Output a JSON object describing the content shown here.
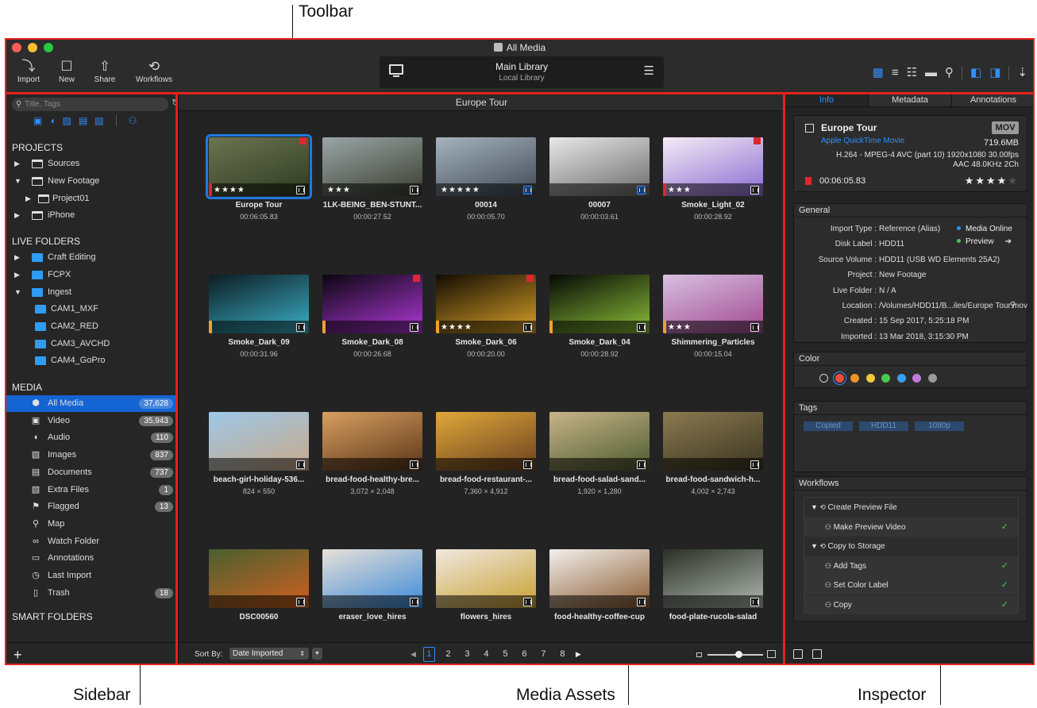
{
  "callouts": {
    "toolbar": "Toolbar",
    "sidebar": "Sidebar",
    "media_assets": "Media Assets",
    "inspector": "Inspector"
  },
  "window": {
    "title": "All Media",
    "traffic_light_colors": [
      "#fc5f57",
      "#fdbc2e",
      "#28c840"
    ]
  },
  "toolbar": {
    "buttons": [
      {
        "label": "Import",
        "icon": "import-icon"
      },
      {
        "label": "New",
        "icon": "new-icon"
      },
      {
        "label": "Share",
        "icon": "share-icon"
      },
      {
        "label": "Workflows",
        "icon": "workflows-icon"
      }
    ],
    "library": {
      "title": "Main Library",
      "subtitle": "Local Library"
    },
    "view_icons": [
      "grid-view-icon",
      "list-view-icon",
      "detail-list-icon",
      "filmstrip-view-icon",
      "map-view-icon",
      "sidebar-toggle-icon",
      "inspector-toggle-icon",
      "sort-icon"
    ],
    "accent": "#2f8fff"
  },
  "sidebar": {
    "search_placeholder": "Title, Tags",
    "filter_icons": [
      "video-filter-icon",
      "audio-filter-icon",
      "image-filter-icon",
      "document-filter-icon",
      "extra-filter-icon",
      "hierarchy-icon"
    ],
    "sections": {
      "projects": "PROJECTS",
      "live_folders": "LIVE FOLDERS",
      "media": "MEDIA",
      "smart_folders": "SMART FOLDERS"
    },
    "projects": [
      {
        "label": "Sources"
      },
      {
        "label": "New Footage"
      },
      {
        "label": "Project01"
      },
      {
        "label": "iPhone"
      }
    ],
    "live_folders": [
      {
        "label": "Craft Editing"
      },
      {
        "label": "FCPX"
      },
      {
        "label": "Ingest"
      },
      {
        "label": "CAM1_MXF"
      },
      {
        "label": "CAM2_RED"
      },
      {
        "label": "CAM3_AVCHD"
      },
      {
        "label": "CAM4_GoPro"
      }
    ],
    "media": [
      {
        "label": "All Media",
        "count": "37,628",
        "icon": "all-media-icon"
      },
      {
        "label": "Video",
        "count": "35,943",
        "icon": "video-icon"
      },
      {
        "label": "Audio",
        "count": "110",
        "icon": "audio-icon"
      },
      {
        "label": "Images",
        "count": "837",
        "icon": "images-icon"
      },
      {
        "label": "Documents",
        "count": "737",
        "icon": "documents-icon"
      },
      {
        "label": "Extra Files",
        "count": "1",
        "icon": "extra-files-icon"
      },
      {
        "label": "Flagged",
        "count": "13",
        "icon": "flag-icon"
      },
      {
        "label": "Map",
        "count": "",
        "icon": "map-pin-icon"
      },
      {
        "label": "Watch Folder",
        "count": "",
        "icon": "binoculars-icon"
      },
      {
        "label": "Annotations",
        "count": "",
        "icon": "annotations-icon"
      },
      {
        "label": "Last Import",
        "count": "",
        "icon": "clock-icon"
      },
      {
        "label": "Trash",
        "count": "18",
        "icon": "trash-icon"
      }
    ]
  },
  "main": {
    "title": "Europe Tour",
    "assets": [
      {
        "name": "Europe Tour",
        "meta": "00:06:05.83",
        "stars": "★★★★",
        "kind": "video",
        "color": "#e0262f",
        "flag": true,
        "selected": true,
        "thumb": [
          "#6c7450",
          "#2e3a22"
        ]
      },
      {
        "name": "1LK-BEING_BEN-STUNT...",
        "meta": "00:00:27.52",
        "stars": "★★★",
        "kind": "video",
        "color": "",
        "flag": false,
        "selected": false,
        "thumb": [
          "#9aa6a6",
          "#3a3d30"
        ]
      },
      {
        "name": "00014",
        "meta": "00:00:05.70",
        "stars": "★★★★★",
        "kind": "video-blue",
        "color": "",
        "flag": false,
        "selected": false,
        "thumb": [
          "#a6b2be",
          "#3f4a55"
        ]
      },
      {
        "name": "00007",
        "meta": "00:00:03.61",
        "stars": "",
        "kind": "video-blue",
        "color": "",
        "flag": false,
        "selected": false,
        "thumb": [
          "#e8e8e8",
          "#6a6a6a"
        ]
      },
      {
        "name": "Smoke_Light_02",
        "meta": "00:00:28.92",
        "stars": "★★★",
        "kind": "video",
        "color": "#e0262f",
        "flag": true,
        "selected": false,
        "thumb": [
          "#f4ecf6",
          "#8b6bd1"
        ]
      },
      {
        "name": "Smoke_Dark_09",
        "meta": "00:00:31.96",
        "stars": "",
        "kind": "video",
        "color": "#f0a030",
        "flag": false,
        "selected": false,
        "thumb": [
          "#0c1c22",
          "#3cb0c8"
        ]
      },
      {
        "name": "Smoke_Dark_08",
        "meta": "00:00:26.68",
        "stars": "",
        "kind": "video",
        "color": "#f0a030",
        "flag": true,
        "selected": false,
        "thumb": [
          "#0a0610",
          "#b038d8"
        ]
      },
      {
        "name": "Smoke_Dark_06",
        "meta": "00:00:20.00",
        "stars": "★★★★",
        "kind": "video",
        "color": "#f0a030",
        "flag": true,
        "selected": false,
        "thumb": [
          "#120c02",
          "#d8a028"
        ]
      },
      {
        "name": "Smoke_Dark_04",
        "meta": "00:00:28.92",
        "stars": "",
        "kind": "video",
        "color": "#f0a030",
        "flag": false,
        "selected": false,
        "thumb": [
          "#050805",
          "#8cc038"
        ]
      },
      {
        "name": "Shimmering_Particles",
        "meta": "00:00:15.04",
        "stars": "★★★",
        "kind": "video",
        "color": "#f0a030",
        "flag": false,
        "selected": false,
        "thumb": [
          "#d8c0e0",
          "#a04890"
        ]
      },
      {
        "name": "beach-girl-holiday-536...",
        "meta": "824 × 550",
        "stars": "",
        "kind": "image",
        "color": "",
        "flag": false,
        "selected": false,
        "thumb": [
          "#9ec8e8",
          "#c8a888"
        ]
      },
      {
        "name": "bread-food-healthy-bre...",
        "meta": "3,072 × 2,048",
        "stars": "",
        "kind": "image",
        "color": "",
        "flag": false,
        "selected": false,
        "thumb": [
          "#d8a060",
          "#5a3418"
        ]
      },
      {
        "name": "bread-food-restaurant-...",
        "meta": "7,360 × 4,912",
        "stars": "",
        "kind": "image",
        "color": "",
        "flag": false,
        "selected": false,
        "thumb": [
          "#e0a838",
          "#6a4020"
        ]
      },
      {
        "name": "bread-food-salad-sand...",
        "meta": "1,920 × 1,280",
        "stars": "",
        "kind": "image",
        "color": "",
        "flag": false,
        "selected": false,
        "thumb": [
          "#c8b488",
          "#4c5a30"
        ]
      },
      {
        "name": "bread-food-sandwich-h...",
        "meta": "4,002 × 2,743",
        "stars": "",
        "kind": "image",
        "color": "",
        "flag": false,
        "selected": false,
        "thumb": [
          "#8a7a50",
          "#3a3420"
        ]
      },
      {
        "name": "DSC00560",
        "meta": "",
        "stars": "",
        "kind": "image",
        "color": "",
        "flag": false,
        "selected": false,
        "thumb": [
          "#4a6030",
          "#d06020"
        ]
      },
      {
        "name": "eraser_love_hires",
        "meta": "",
        "stars": "",
        "kind": "image",
        "color": "",
        "flag": false,
        "selected": false,
        "thumb": [
          "#e8e0d8",
          "#3a8ad8"
        ]
      },
      {
        "name": "flowers_hires",
        "meta": "",
        "stars": "",
        "kind": "image",
        "color": "",
        "flag": false,
        "selected": false,
        "thumb": [
          "#f0e8e0",
          "#c8a030"
        ]
      },
      {
        "name": "food-healthy-coffee-cup",
        "meta": "",
        "stars": "",
        "kind": "image",
        "color": "",
        "flag": false,
        "selected": false,
        "thumb": [
          "#f2f0ec",
          "#8a5a30"
        ]
      },
      {
        "name": "food-plate-rucola-salad",
        "meta": "",
        "stars": "",
        "kind": "image",
        "color": "",
        "flag": false,
        "selected": false,
        "thumb": [
          "#2a3028",
          "#b0b8b0"
        ]
      }
    ],
    "sort_label": "Sort By:",
    "sort_value": "Date Imported",
    "pages": [
      "1",
      "2",
      "3",
      "4",
      "5",
      "6",
      "7",
      "8"
    ],
    "current_page": "1",
    "zoom_level": 0.5
  },
  "inspector": {
    "tabs": [
      "Info",
      "Metadata",
      "Annotations"
    ],
    "active_tab": "Info",
    "clip": {
      "name": "Europe Tour",
      "format": "Apple QuickTime Movie",
      "badge": "MOV",
      "size": "719.6MB",
      "codec": "H.264 - MPEG-4 AVC (part 10) 1920x1080 30.00fps",
      "audio": "AAC 48.0KHz 2Ch",
      "duration": "00:06:05.83",
      "rating": "★★★★",
      "rating_empty": "★"
    },
    "general_title": "General",
    "general": [
      {
        "k": "Import Type :",
        "v": "Reference (Alias)"
      },
      {
        "k": "Disk Label :",
        "v": "HDD11"
      },
      {
        "k": "Source Volume :",
        "v": "HDD11 (USB WD Elements 25A2)"
      },
      {
        "k": "Project :",
        "v": "New Footage"
      },
      {
        "k": "Live Folder :",
        "v": "N / A"
      },
      {
        "k": "Location :",
        "v": "/Volumes/HDD11/B...iles/Europe Tour.mov"
      },
      {
        "k": "Created :",
        "v": "15 Sep 2017, 5:25:18 PM"
      },
      {
        "k": "Imported :",
        "v": "13 Mar 2018, 3:15:30 PM"
      }
    ],
    "status": [
      {
        "label": "Media Online",
        "color": "#2f8fff"
      },
      {
        "label": "Preview",
        "color": "#47c94e"
      }
    ],
    "color_title": "Color",
    "colors": [
      "none",
      "#f04a3a",
      "#f0922a",
      "#f0c93a",
      "#47c94e",
      "#3a9ef0",
      "#c07ad8",
      "#9a9a9a"
    ],
    "selected_color": "#f04a3a",
    "tags_title": "Tags",
    "tags": [
      "Copied",
      "HDD11",
      "1080p"
    ],
    "workflows_title": "Workflows",
    "workflows": [
      {
        "label": "Create Preview File",
        "group": true,
        "done": false
      },
      {
        "label": "Make Preview Video",
        "group": false,
        "done": true
      },
      {
        "label": "Copy to Storage",
        "group": true,
        "done": false
      },
      {
        "label": "Add Tags",
        "group": false,
        "done": true
      },
      {
        "label": "Set Color Label",
        "group": false,
        "done": true
      },
      {
        "label": "Copy",
        "group": false,
        "done": true
      }
    ],
    "check": "✓"
  }
}
